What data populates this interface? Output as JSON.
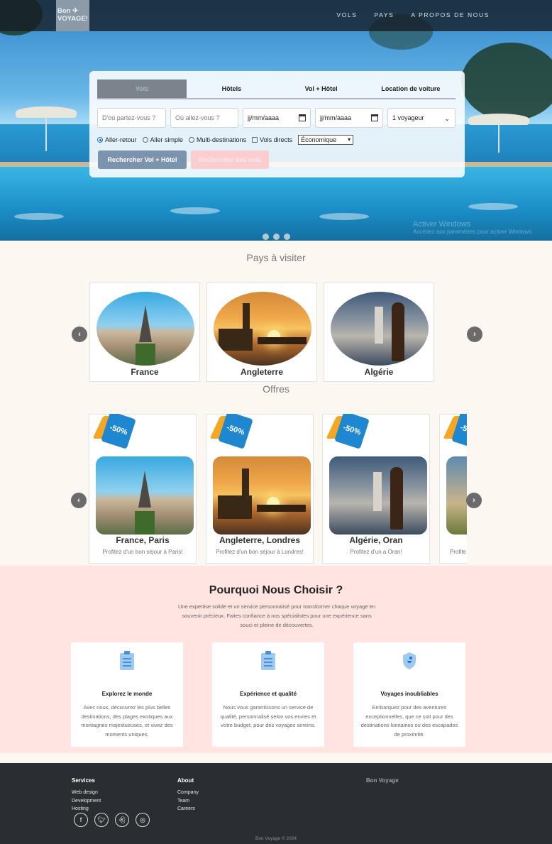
{
  "nav": {
    "logo_line1": "Bon",
    "logo_line2": "VOYAGE!",
    "links": [
      "VOLS",
      "PAYS",
      "A PROPOS DE NOUS"
    ]
  },
  "search": {
    "tabs": [
      "Vols",
      "Hôtels",
      "Vol + Hôtel",
      "Location de voiture"
    ],
    "active_tab": "Vols",
    "from_placeholder": "D'où partez-vous ?",
    "to_placeholder": "Où allez-vous ?",
    "depart_date": "jj/mm/aaaa",
    "return_date": "jj/mm/aaaa",
    "travelers": "1 voyageur",
    "trip_types": [
      "Aller-retour",
      "Aller simple",
      "Multi-destinations"
    ],
    "selected_trip_type": "Aller-retour",
    "direct_flights_label": "Vols directs",
    "cabin_class": "Économique",
    "btn_flight_hotel": "Rechercher Vol + Hôtel",
    "btn_flights": "Rechercher des vols"
  },
  "watermark": {
    "line1": "Activer Windows",
    "line2": "Accédez aux paramètres pour activer Windows."
  },
  "countries": {
    "title": "Pays à visiter",
    "items": [
      "France",
      "Angleterre",
      "Algérie"
    ]
  },
  "offers": {
    "title": "Offres",
    "discount": "-50%",
    "items": [
      {
        "title": "France, Paris",
        "desc": "Profitez d'un bon séjour à Paris!"
      },
      {
        "title": "Angleterre, Londres",
        "desc": "Profitez d'un bon séjour à Londres!"
      },
      {
        "title": "Algérie, Oran",
        "desc": "Profitez d'un a Oran!"
      },
      {
        "title": "",
        "desc": "Profite"
      }
    ]
  },
  "why": {
    "title": "Pourquoi Nous Choisir ?",
    "intro": "Une expertise solide et un service personnalisé pour transformer chaque voyage en souvenir précieux. Faites confiance à nos spécialistes pour une expérience sans souci et pleine de découvertes.",
    "features": [
      {
        "title": "Explorez le monde",
        "desc": "Avec nous, découvrez les plus belles destinations, des plages exotiques aux montagnes majestueuses, et vivez des moments uniques.",
        "icon": "clipboard-icon"
      },
      {
        "title": "Expérience et qualité",
        "desc": "Nous vous garantissons un service de qualité, personnalisé selon vos envies et votre budget, pour des voyages sereins.",
        "icon": "clipboard-icon"
      },
      {
        "title": "Voyages inoubliables",
        "desc": "Embarquez pour des aventures exceptionnelles, que ce soit pour des destinations lointaines ou des escapades de proximité.",
        "icon": "shield-icon"
      }
    ]
  },
  "footer": {
    "services_title": "Services",
    "services": [
      "Web design",
      "Development",
      "Hosting"
    ],
    "about_title": "About",
    "about": [
      "Company",
      "Team",
      "Careers"
    ],
    "brand": "Bon Voyage",
    "copyright": "Bon Voyage © 2024",
    "socials": [
      "facebook-icon",
      "twitter-icon",
      "snapchat-icon",
      "instagram-icon"
    ]
  },
  "colors": {
    "nav_bg": "#161c22",
    "btn_primary": "#7b93ad",
    "btn_secondary": "#fbcdce",
    "why_bg": "#ffe4e2",
    "footer_bg": "#2a2e33",
    "tag_blue": "#1f86d0",
    "tag_orange": "#f5a623"
  }
}
